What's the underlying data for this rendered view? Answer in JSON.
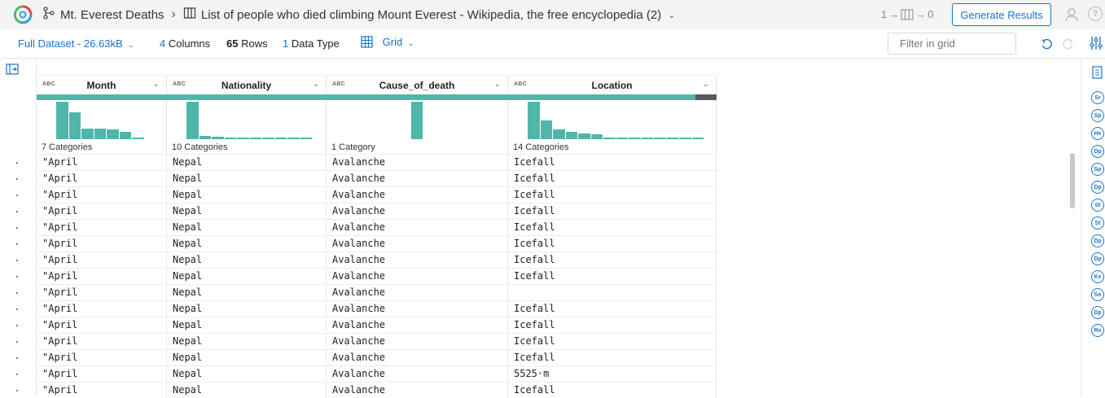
{
  "header": {
    "project": "Mt. Everest Deaths",
    "dataset_title": "List of people who died climbing Mount Everest - Wikipedia, the free encyclopedia (2)",
    "steps_left": "1",
    "steps_right": "0",
    "generate_button": "Generate Results"
  },
  "toolbar": {
    "dataset_scope": "Full Dataset - 26.63kB",
    "columns_count": "4",
    "columns_label": "Columns",
    "rows_count": "65",
    "rows_label": "Rows",
    "types_count": "1",
    "types_label": "Data Type",
    "view_label": "Grid",
    "filter_placeholder": "Filter in grid"
  },
  "columns": [
    {
      "type": "ABC",
      "name": "Month",
      "categories": "7 Categories",
      "hist": [
        1.0,
        0.72,
        0.28,
        0.28,
        0.26,
        0.2,
        0.05
      ]
    },
    {
      "type": "ABC",
      "name": "Nationality",
      "categories": "10 Categories",
      "hist": [
        1.0,
        0.08,
        0.06,
        0.05,
        0.05,
        0.05,
        0.05,
        0.05,
        0.05,
        0.05
      ]
    },
    {
      "type": "ABC",
      "name": "Cause_of_death",
      "categories": "1 Category",
      "hist": [
        1.0
      ]
    },
    {
      "type": "ABC",
      "name": "Location",
      "categories": "14 Categories",
      "hist": [
        1.0,
        0.5,
        0.26,
        0.2,
        0.16,
        0.14,
        0.05,
        0.05,
        0.05,
        0.05,
        0.05,
        0.05,
        0.05,
        0.05
      ]
    }
  ],
  "location_quality_missing_fraction": 0.1,
  "rows": [
    [
      "\"April",
      "Nepal",
      "Avalanche",
      "Icefall"
    ],
    [
      "\"April",
      "Nepal",
      "Avalanche",
      "Icefall"
    ],
    [
      "\"April",
      "Nepal",
      "Avalanche",
      "Icefall"
    ],
    [
      "\"April",
      "Nepal",
      "Avalanche",
      "Icefall"
    ],
    [
      "\"April",
      "Nepal",
      "Avalanche",
      "Icefall"
    ],
    [
      "\"April",
      "Nepal",
      "Avalanche",
      "Icefall"
    ],
    [
      "\"April",
      "Nepal",
      "Avalanche",
      "Icefall"
    ],
    [
      "\"April",
      "Nepal",
      "Avalanche",
      "Icefall"
    ],
    [
      "\"April",
      "Nepal",
      "Avalanche",
      ""
    ],
    [
      "\"April",
      "Nepal",
      "Avalanche",
      "Icefall"
    ],
    [
      "\"April",
      "Nepal",
      "Avalanche",
      "Icefall"
    ],
    [
      "\"April",
      "Nepal",
      "Avalanche",
      "Icefall"
    ],
    [
      "\"April",
      "Nepal",
      "Avalanche",
      "Icefall"
    ],
    [
      "\"April",
      "Nepal",
      "Avalanche",
      "5525·m"
    ],
    [
      "\"April",
      "Nepal",
      "Avalanche",
      "Icefall"
    ]
  ],
  "right_panel_badges": [
    "Sr",
    "Sp",
    "He",
    "Dp",
    "Sp",
    "Dp",
    "St",
    "St",
    "Dp",
    "Dp",
    "Ke",
    "So",
    "Dp",
    "Rn"
  ],
  "colors": {
    "accent": "#1a73c8",
    "histogram": "#4fb7a8",
    "missing": "#5a5a5a"
  }
}
